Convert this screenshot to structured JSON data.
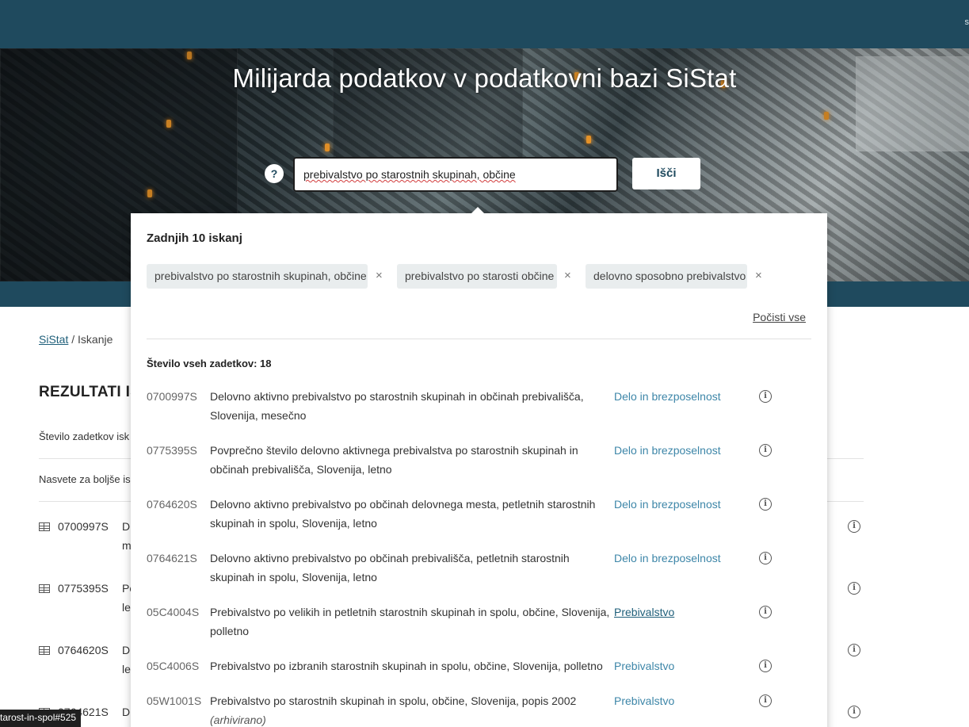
{
  "header": {
    "edge_text": "s"
  },
  "hero": {
    "title": "Milijarda podatkov v podatkovni bazi SiStat",
    "help_label": "?",
    "search_value": "prebivalstvo po starostnih skupinah, občine",
    "search_button": "Išči"
  },
  "breadcrumb": {
    "home": "SiStat",
    "separator": " / ",
    "current": "Iskanje"
  },
  "results": {
    "title": "REZULTATI IS",
    "count_label": "Število zadetkov isk",
    "hints_label": "Nasvete za boljše is",
    "rows": [
      {
        "code": "0700997S",
        "l1": "D",
        "l2": "m"
      },
      {
        "code": "0775395S",
        "l1": "Po",
        "l2": "le"
      },
      {
        "code": "0764620S",
        "l1": "D",
        "l2": "le"
      },
      {
        "code": "0764621S",
        "l1": "D",
        "l2": ""
      }
    ]
  },
  "dropdown": {
    "recent_title": "Zadnjih 10 iskanj",
    "recent": [
      "prebivalstvo po starostnih skupinah, občine",
      "prebivalstvo po starosti občine",
      "delovno sposobno prebivalstvo"
    ],
    "remove_glyph": "×",
    "clear_all": "Počisti vse",
    "total_label": "Število vseh zadetkov: 18",
    "info_glyph": "i",
    "items": [
      {
        "code": "0700997S",
        "title": "Delovno aktivno prebivalstvo po starostnih skupinah in občinah prebivališča, Slovenija, mesečno",
        "note": "",
        "category": "Delo in brezposelnost"
      },
      {
        "code": "0775395S",
        "title": "Povprečno število delovno aktivnega prebivalstva po starostnih skupinah in občinah prebivališča, Slovenija, letno",
        "note": "",
        "category": "Delo in brezposelnost"
      },
      {
        "code": "0764620S",
        "title": "Delovno aktivno prebivalstvo po občinah delovnega mesta, petletnih starostnih skupinah in spolu, Slovenija, letno",
        "note": "",
        "category": "Delo in brezposelnost"
      },
      {
        "code": "0764621S",
        "title": "Delovno aktivno prebivalstvo po občinah prebivališča, petletnih starostnih skupinah in spolu, Slovenija, letno",
        "note": "",
        "category": "Delo in brezposelnost"
      },
      {
        "code": "05C4004S",
        "title": "Prebivalstvo po velikih in petletnih starostnih skupinah in spolu, občine, Slovenija, polletno",
        "note": "",
        "category": "Prebivalstvo"
      },
      {
        "code": "05C4006S",
        "title": "Prebivalstvo po izbranih starostnih skupinah in spolu, občine, Slovenija, polletno",
        "note": "",
        "category": "Prebivalstvo"
      },
      {
        "code": "05W1001S",
        "title": "Prebivalstvo po starostnih skupinah in spolu, občine, Slovenija, popis 2002",
        "note": "(arhivirano)",
        "category": "Prebivalstvo"
      }
    ]
  },
  "status_bar": {
    "url": "tarost-in-spol#525"
  },
  "colors": {
    "brand": "#1f4a5e",
    "link": "#3d86a8",
    "chip_bg": "#e9edee"
  }
}
